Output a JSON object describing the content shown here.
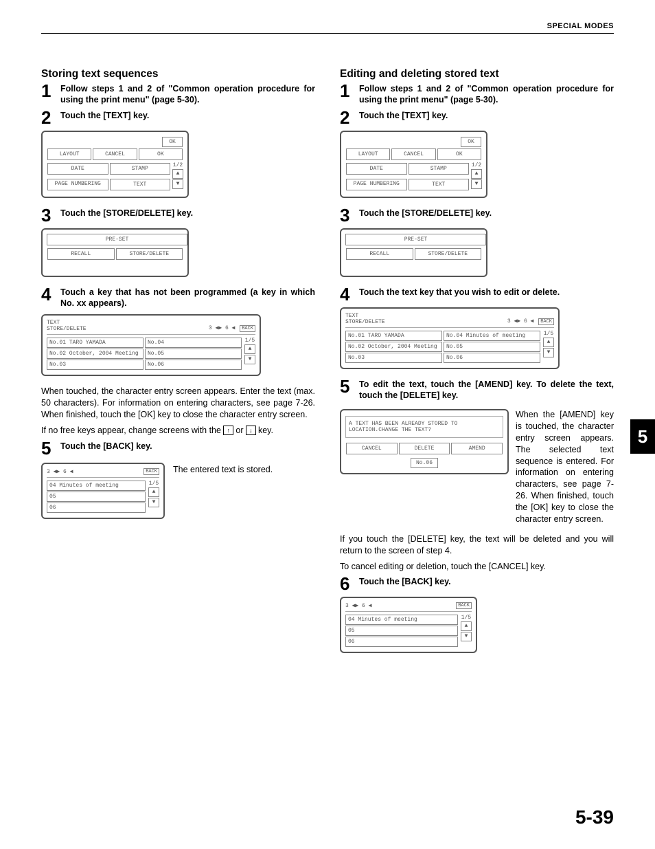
{
  "header": "SPECIAL MODES",
  "side_tab": "5",
  "page_number": "5-39",
  "left": {
    "title": "Storing text sequences",
    "steps": {
      "1": "Follow steps 1 and 2 of \"Common operation procedure for using the print menu\" (page 5-30).",
      "2": "Touch the [TEXT] key.",
      "3": "Touch the [STORE/DELETE] key.",
      "4": "Touch a key that has not been programmed (a key in which No. xx appears).",
      "4body_a": "When touched, the character entry screen appears. Enter the text (max. 50 characters). For information on entering characters, see page 7-26. When finished, touch the [OK] key to close the character entry screen.",
      "4body_b_pre": "If no free keys appear, change screens with the ",
      "4body_b_or": " or ",
      "4body_b_post": " key.",
      "5": "Touch the [BACK] key.",
      "5body": "The entered text is stored."
    }
  },
  "right": {
    "title": "Editing and deleting stored text",
    "steps": {
      "1": "Follow steps 1 and 2 of \"Common operation procedure for using the print menu\" (page 5-30).",
      "2": "Touch the [TEXT] key.",
      "3": "Touch the [STORE/DELETE] key.",
      "4": "Touch the text key that you wish to edit or delete.",
      "5": "To edit the text, touch the [AMEND] key. To delete the text, touch the [DELETE] key.",
      "5body_a": "When the [AMEND] key is touched, the character entry screen appears. The selected text sequence is entered. For information on entering characters, see page 7-26. When finished, touch the [OK] key to close the character entry screen.",
      "5body_b": "If you touch the [DELETE] key, the text will be deleted and you will return to the screen of step 4.",
      "5body_c": "To cancel editing or deletion, touch the [CANCEL] key.",
      "6": "Touch the [BACK] key."
    }
  },
  "screens": {
    "menu": {
      "ok": "OK",
      "layout": "LAYOUT",
      "cancel": "CANCEL",
      "date": "DATE",
      "stamp": "STAMP",
      "page_numbering": "PAGE NUMBERING",
      "text": "TEXT",
      "page": "1/2"
    },
    "preset": {
      "title": "PRE-SET",
      "recall": "RECALL",
      "store_delete": "STORE/DELETE"
    },
    "list_left": {
      "breadcrumb1": "TEXT",
      "breadcrumb2": "STORE/DELETE",
      "back": "BACK",
      "page": "1/5",
      "nav": "3   ◀▶ 6   ◀",
      "r1a": "No.01 TARO YAMADA",
      "r1b": "No.04",
      "r2a": "No.02 October, 2004 Meeting",
      "r2b": "No.05",
      "r3a": "No.03",
      "r3b": "No.06"
    },
    "list_right": {
      "breadcrumb1": "TEXT",
      "breadcrumb2": "STORE/DELETE",
      "back": "BACK",
      "page": "1/5",
      "nav": "3   ◀▶ 6   ◀",
      "r1a": "No.01 TARO YAMADA",
      "r1b": "No.04 Minutes of meeting",
      "r2a": "No.02 October, 2004 Meeting",
      "r2b": "No.05",
      "r3a": "No.03",
      "r3b": "No.06"
    },
    "back_screen": {
      "nav": "3   ◀▶ 6   ◀",
      "back": "BACK",
      "page": "1/5",
      "r1": "04 Minutes of meeting",
      "r2": "05",
      "r3": "06"
    },
    "dialog": {
      "msg": "A TEXT HAS BEEN ALREADY STORED TO LOCATION.CHANGE THE TEXT?",
      "cancel": "CANCEL",
      "delete": "DELETE",
      "amend": "AMEND",
      "slot": "No.06"
    }
  },
  "keys": {
    "up": "↑",
    "down": "↓"
  }
}
